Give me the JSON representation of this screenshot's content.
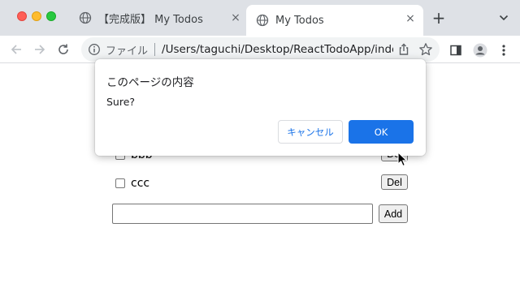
{
  "tabs": [
    {
      "title": "【完成版】 My Todos",
      "close": "×"
    },
    {
      "title": "My Todos",
      "close": "×",
      "active": true
    }
  ],
  "new_tab_glyph": "+",
  "tab_menu_glyph": "⌄",
  "address_bar": {
    "scheme_label": "ファイル",
    "url": "/Users/taguchi/Desktop/ReactTodoApp/index...."
  },
  "todos": [
    {
      "text": "bbb",
      "delete_label": "Del",
      "checked": false
    },
    {
      "text": "ccc",
      "delete_label": "Del",
      "checked": false
    }
  ],
  "new_todo": {
    "value": "",
    "add_label": "Add"
  },
  "dialog": {
    "title": "このページの内容",
    "message": "Sure?",
    "cancel_label": "キャンセル",
    "ok_label": "OK"
  },
  "colors": {
    "accent": "#1a73e8",
    "tabstrip": "#dee1e6",
    "omnibox": "#f1f3f4"
  },
  "icons": [
    "globe-icon",
    "close-icon",
    "plus-icon",
    "back-icon",
    "forward-icon",
    "reload-icon",
    "info-icon",
    "share-icon",
    "star-icon",
    "sidebar-icon",
    "profile-icon",
    "menu-icon"
  ]
}
